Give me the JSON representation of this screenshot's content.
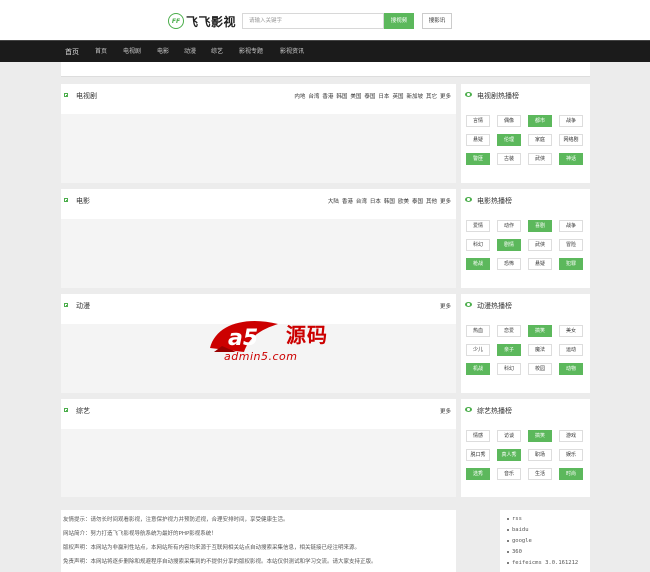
{
  "header": {
    "logo_mark": "FF",
    "logo_text": "飞飞影视",
    "search_placeholder": "请输入关键字",
    "search_button": "搜视频",
    "search_button2": "搜影讯"
  },
  "nav": [
    "首页",
    "首页",
    "电视剧",
    "电影",
    "动漫",
    "综艺",
    "影视专题",
    "影视资讯"
  ],
  "sections": [
    {
      "title": "电视剧",
      "links": [
        "内地",
        "台湾",
        "香港",
        "韩国",
        "美国",
        "泰国",
        "日本",
        "英国",
        "新加坡",
        "其它",
        "更多"
      ]
    },
    {
      "title": "电影",
      "links": [
        "大陆",
        "香港",
        "台湾",
        "日本",
        "韩国",
        "欧美",
        "泰国",
        "其他",
        "更多"
      ]
    },
    {
      "title": "动漫",
      "links": [
        "更多"
      ]
    },
    {
      "title": "综艺",
      "links": [
        "更多"
      ]
    }
  ],
  "side": [
    {
      "title": "电视剧热播榜",
      "tags": [
        {
          "label": "言情",
          "active": false
        },
        {
          "label": "偶像",
          "active": false
        },
        {
          "label": "都市",
          "active": true
        },
        {
          "label": "战争",
          "active": false
        },
        {
          "label": "悬疑",
          "active": false
        },
        {
          "label": "伦理",
          "active": true
        },
        {
          "label": "家庭",
          "active": false
        },
        {
          "label": "网络剧",
          "active": false
        },
        {
          "label": "警匪",
          "active": true
        },
        {
          "label": "古装",
          "active": false
        },
        {
          "label": "武侠",
          "active": false
        },
        {
          "label": "神话",
          "active": true
        }
      ]
    },
    {
      "title": "电影热播榜",
      "tags": [
        {
          "label": "爱情",
          "active": false
        },
        {
          "label": "动作",
          "active": false
        },
        {
          "label": "喜剧",
          "active": true
        },
        {
          "label": "战争",
          "active": false
        },
        {
          "label": "科幻",
          "active": false
        },
        {
          "label": "剧情",
          "active": true
        },
        {
          "label": "武侠",
          "active": false
        },
        {
          "label": "冒险",
          "active": false
        },
        {
          "label": "枪战",
          "active": true
        },
        {
          "label": "恐怖",
          "active": false
        },
        {
          "label": "悬疑",
          "active": false
        },
        {
          "label": "犯罪",
          "active": true
        }
      ]
    },
    {
      "title": "动漫热播榜",
      "tags": [
        {
          "label": "热血",
          "active": false
        },
        {
          "label": "恋爱",
          "active": false
        },
        {
          "label": "搞笑",
          "active": true
        },
        {
          "label": "美女",
          "active": false
        },
        {
          "label": "少儿",
          "active": false
        },
        {
          "label": "亲子",
          "active": true
        },
        {
          "label": "魔法",
          "active": false
        },
        {
          "label": "运动",
          "active": false
        },
        {
          "label": "机战",
          "active": true
        },
        {
          "label": "科幻",
          "active": false
        },
        {
          "label": "校园",
          "active": false
        },
        {
          "label": "动物",
          "active": true
        }
      ]
    },
    {
      "title": "综艺热播榜",
      "tags": [
        {
          "label": "情感",
          "active": false
        },
        {
          "label": "访谈",
          "active": false
        },
        {
          "label": "搞笑",
          "active": true
        },
        {
          "label": "游戏",
          "active": false
        },
        {
          "label": "脱口秀",
          "active": false
        },
        {
          "label": "真人秀",
          "active": true
        },
        {
          "label": "职场",
          "active": false
        },
        {
          "label": "娱乐",
          "active": false
        },
        {
          "label": "选秀",
          "active": true
        },
        {
          "label": "音乐",
          "active": false
        },
        {
          "label": "生活",
          "active": false
        },
        {
          "label": "时尚",
          "active": true
        }
      ]
    }
  ],
  "watermark": {
    "badge": "a5",
    "hanzi": "源码",
    "url": "admin5.com"
  },
  "footer": {
    "lines": [
      "友情提示：请勿长时间观看影视，注意保护视力并预防近视，合理安排时间，享受健康生活。",
      "网站简介：努力打造飞飞影视导航系统为最好的PHP影视系统！",
      "版权声明：本网站为非赢利性站点，本网站所有内容均来源于互联网相关站点自动搜索采集信息，相关链接已经注明来源。",
      "免责声明：本网站将逐步删除和规避程序自动搜索采集到的不提供分享的版权影视。本站仅供测试和学习交流。请大家支持正版。"
    ],
    "links": [
      "rss",
      "baidu",
      "google",
      "360",
      "feifeicms 3.0.161212"
    ]
  },
  "colors": {
    "accent": "#5cb85c",
    "nav_bg": "#1b1b1b",
    "watermark": "#cc0000"
  }
}
